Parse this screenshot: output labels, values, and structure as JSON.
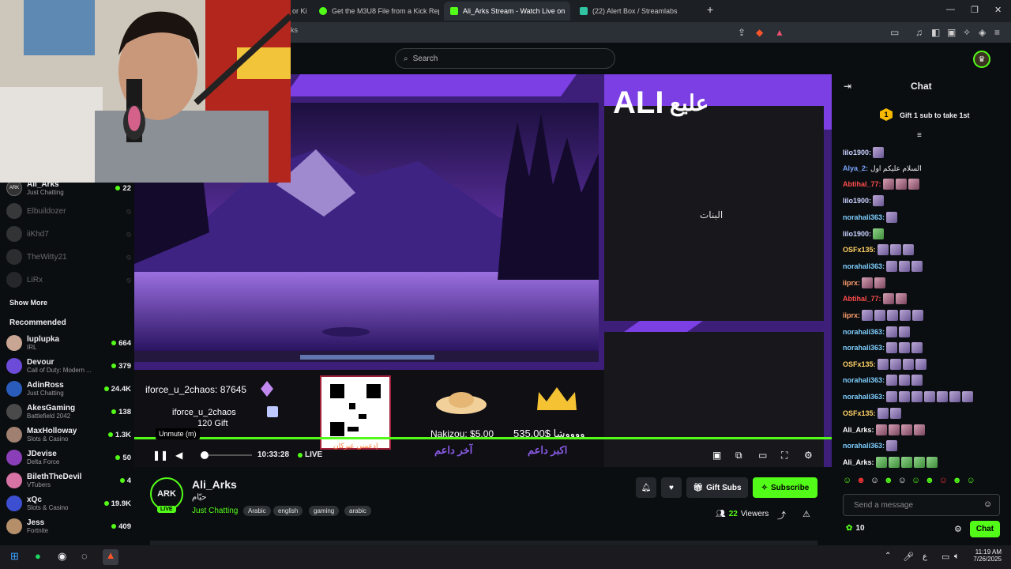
{
  "browser": {
    "tabs": [
      {
        "label": "or Ki"
      },
      {
        "label": "Get the M3U8 File from a Kick Replay"
      },
      {
        "label": "Ali_Arks Stream - Watch Live on"
      },
      {
        "label": "(22) Alert Box / Streamlabs"
      }
    ],
    "url_fragment": "ks",
    "new_tab": "+",
    "tab_close": "×",
    "win": {
      "min": "—",
      "max": "❐",
      "close": "✕"
    }
  },
  "header": {
    "search_placeholder": "Search"
  },
  "sidebar": {
    "following": [
      {
        "name": "Ali_Arks",
        "category": "Just Chatting",
        "viewers": "22",
        "live": true
      },
      {
        "name": "Elbuildozer",
        "live": false
      },
      {
        "name": "iiKhd7",
        "live": false
      },
      {
        "name": "TheWitty21",
        "live": false
      },
      {
        "name": "LiRx",
        "live": false
      }
    ],
    "show_more": "Show More",
    "recommended_heading": "Recommended",
    "recommended": [
      {
        "name": "luplupka",
        "category": "IRL",
        "viewers": "664"
      },
      {
        "name": "Devour",
        "category": "Call of Duty: Modern ...",
        "viewers": "379"
      },
      {
        "name": "AdinRoss",
        "category": "Just Chatting",
        "viewers": "24.4K"
      },
      {
        "name": "AkesGaming",
        "category": "Battlefield 2042",
        "viewers": "138"
      },
      {
        "name": "MaxHolloway",
        "category": "Slots & Casino",
        "viewers": "1.3K"
      },
      {
        "name": "JDevise",
        "category": "Delta Force",
        "viewers": "50"
      },
      {
        "name": "BilethTheDevil",
        "category": "VTubers",
        "viewers": "4"
      },
      {
        "name": "xQc",
        "category": "Slots & Casino",
        "viewers": "19.9K"
      },
      {
        "name": "Jess",
        "category": "Fortnite",
        "viewers": "409"
      }
    ]
  },
  "overlay": {
    "stream_logo": "ALI",
    "arabic_logo": "عليع",
    "banat_text": "البنات",
    "top_donor": "iforce_u_2chaos: 87645",
    "gift_user": "iforce_u_2chaos",
    "gift_count": "120 Gift",
    "qr_caption": "إدعمني عبركان",
    "last_donation": "Nakizou: $5.00",
    "last_label": "آخر داعم",
    "top_donation": "535.00$ ووووشا",
    "top_label": "اكبر داعم"
  },
  "player": {
    "tooltip": "Unmute (m)",
    "time": "10:33:28",
    "live_label": "LIVE"
  },
  "stream_info": {
    "channel_logo": "ARK",
    "live_badge": "LIVE",
    "channel_name": "Ali_Arks",
    "stream_title": "حيّام",
    "category": "Just Chatting",
    "tags": [
      "Arabic",
      "english",
      "gaming",
      "arabic"
    ],
    "gift_subs": "Gift Subs",
    "subscribe": "Subscribe",
    "viewers_count": "22",
    "viewers_label": "Viewers"
  },
  "chat": {
    "title": "Chat",
    "gift_banner_rank": "1",
    "gift_banner": "Gift 1 sub to take 1st",
    "messages": [
      {
        "user": "lilo1900:",
        "color": "#c9d2ff",
        "text": "",
        "emotes": 1
      },
      {
        "user": "Alya_2:",
        "color": "#7aa6ff",
        "text": "السلام عليكم اول",
        "emotes": 0
      },
      {
        "user": "Abtihal_77:",
        "color": "#ff4d4d",
        "text": "",
        "emotes": 3,
        "tone": "pink"
      },
      {
        "user": "lilo1900:",
        "color": "#c9d2ff",
        "text": "",
        "emotes": 1
      },
      {
        "user": "norahali363:",
        "color": "#7ecfff",
        "text": "",
        "emotes": 1
      },
      {
        "user": "lilo1900:",
        "color": "#c9d2ff",
        "text": "",
        "emotes": 1,
        "tone": "green"
      },
      {
        "user": "OSFx135:",
        "color": "#ffd166",
        "text": "",
        "emotes": 3
      },
      {
        "user": "norahali363:",
        "color": "#7ecfff",
        "text": "",
        "emotes": 3
      },
      {
        "user": "iiprx:",
        "color": "#ff9f6e",
        "text": "",
        "emotes": 2,
        "tone": "pink"
      },
      {
        "user": "Abtihal_77:",
        "color": "#ff4d4d",
        "text": "",
        "emotes": 2,
        "tone": "pink"
      },
      {
        "user": "iiprx:",
        "color": "#ff9f6e",
        "text": "",
        "emotes": 5
      },
      {
        "user": "norahali363:",
        "color": "#7ecfff",
        "text": "",
        "emotes": 2
      },
      {
        "user": "norahali363:",
        "color": "#7ecfff",
        "text": "",
        "emotes": 3
      },
      {
        "user": "OSFx135:",
        "color": "#ffd166",
        "text": "",
        "emotes": 4
      },
      {
        "user": "norahali363:",
        "color": "#7ecfff",
        "text": "",
        "emotes": 3
      },
      {
        "user": "norahali363:",
        "color": "#7ecfff",
        "text": "",
        "emotes": 7
      },
      {
        "user": "OSFx135:",
        "color": "#ffd166",
        "text": "",
        "emotes": 2
      },
      {
        "user": "Ali_Arks:",
        "color": "#ffffff",
        "text": "",
        "emotes": 4,
        "tone": "pink"
      },
      {
        "user": "norahali363:",
        "color": "#7ecfff",
        "text": "",
        "emotes": 1
      },
      {
        "user": "Ali_Arks:",
        "color": "#ffffff",
        "text": "",
        "emotes": 5,
        "tone": "green"
      }
    ],
    "input_placeholder": "Send a message",
    "points": "10",
    "send": "Chat"
  },
  "taskbar": {
    "time": "11:19 AM",
    "date": "7/26/2025",
    "lang": "ع"
  },
  "colors": {
    "kick_green": "#53fc18",
    "bg": "#0b0e11"
  }
}
